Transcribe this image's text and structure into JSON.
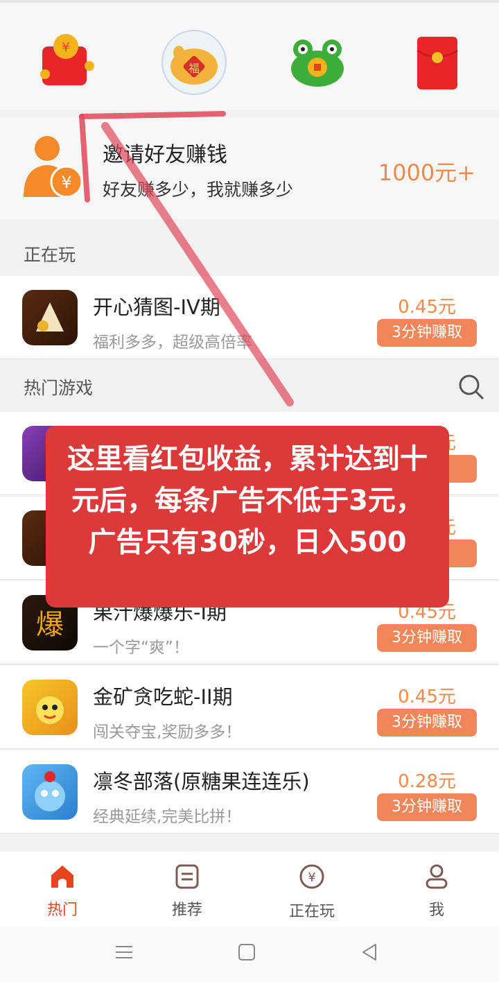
{
  "top_icons": [
    {
      "name": "red-envelope-coins"
    },
    {
      "name": "lucky-piggy-bank",
      "badge": "福"
    },
    {
      "name": "frog-coin"
    },
    {
      "name": "red-packet"
    }
  ],
  "invite": {
    "title": "邀请好友赚钱",
    "subtitle": "好友赚多少，我就赚多少",
    "amount": "1000元+"
  },
  "sections": {
    "playing": "正在玩",
    "hot_games": "热门游戏"
  },
  "playing_games": [
    {
      "name": "开心猜图-IV期",
      "desc": "福利多多，超级高倍率",
      "price": "0.45元",
      "button": "3分钟赚取"
    }
  ],
  "hot_games": [
    {
      "name": "",
      "desc": "",
      "price": "元",
      "button": "取"
    },
    {
      "name": "",
      "desc": "",
      "price": "元",
      "button": "取"
    },
    {
      "name": "果汁爆爆乐-I期",
      "desc": "一个字“爽”！",
      "price": "0.45元",
      "button": "3分钟赚取"
    },
    {
      "name": "金矿贪吃蛇-II期",
      "desc": "闯关夺宝,奖励多多！",
      "price": "0.45元",
      "button": "3分钟赚取"
    },
    {
      "name": "凛冬部落(原糖果连连乐)",
      "desc": "经典延续,完美比拼！",
      "price": "0.28元",
      "button": "3分钟赚取"
    }
  ],
  "overlay_text": "这里看红包收益，累计达到十元后，每条广告不低于3元，广告只有30秒，日入500",
  "bottom_nav": [
    {
      "label": "热门",
      "active": true
    },
    {
      "label": "推荐",
      "active": false
    },
    {
      "label": "正在玩",
      "active": false
    },
    {
      "label": "我",
      "active": false
    }
  ],
  "colors": {
    "accent": "#f0865a",
    "nav_active": "#e8451e",
    "overlay": "#dc3a3a",
    "price": "#f08a4b"
  }
}
